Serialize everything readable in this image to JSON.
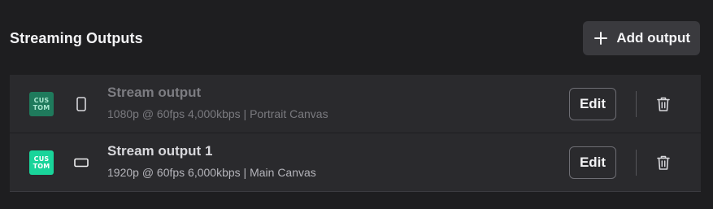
{
  "header": {
    "title": "Streaming Outputs",
    "add_button_label": "Add output",
    "add_icon": "plus-icon"
  },
  "outputs": [
    {
      "badge_line1": "CUS",
      "badge_line2": "TOM",
      "device_icon": "phone-portrait-icon",
      "name": "Stream output",
      "meta": "1080p @ 60fps 4,000kbps | Portrait Canvas",
      "edit_label": "Edit",
      "delete_icon": "trash-icon",
      "state": "dimmed"
    },
    {
      "badge_line1": "CUS",
      "badge_line2": "TOM",
      "device_icon": "landscape-screen-icon",
      "name": "Stream output 1",
      "meta": "1920p @ 60fps 6,000kbps | Main Canvas",
      "edit_label": "Edit",
      "delete_icon": "trash-icon",
      "state": "active"
    }
  ],
  "colors": {
    "background": "#1e1e20",
    "row_background": "#2a2a2d",
    "badge_dim": "#1f7a5c",
    "badge_bright": "#19d49a"
  }
}
